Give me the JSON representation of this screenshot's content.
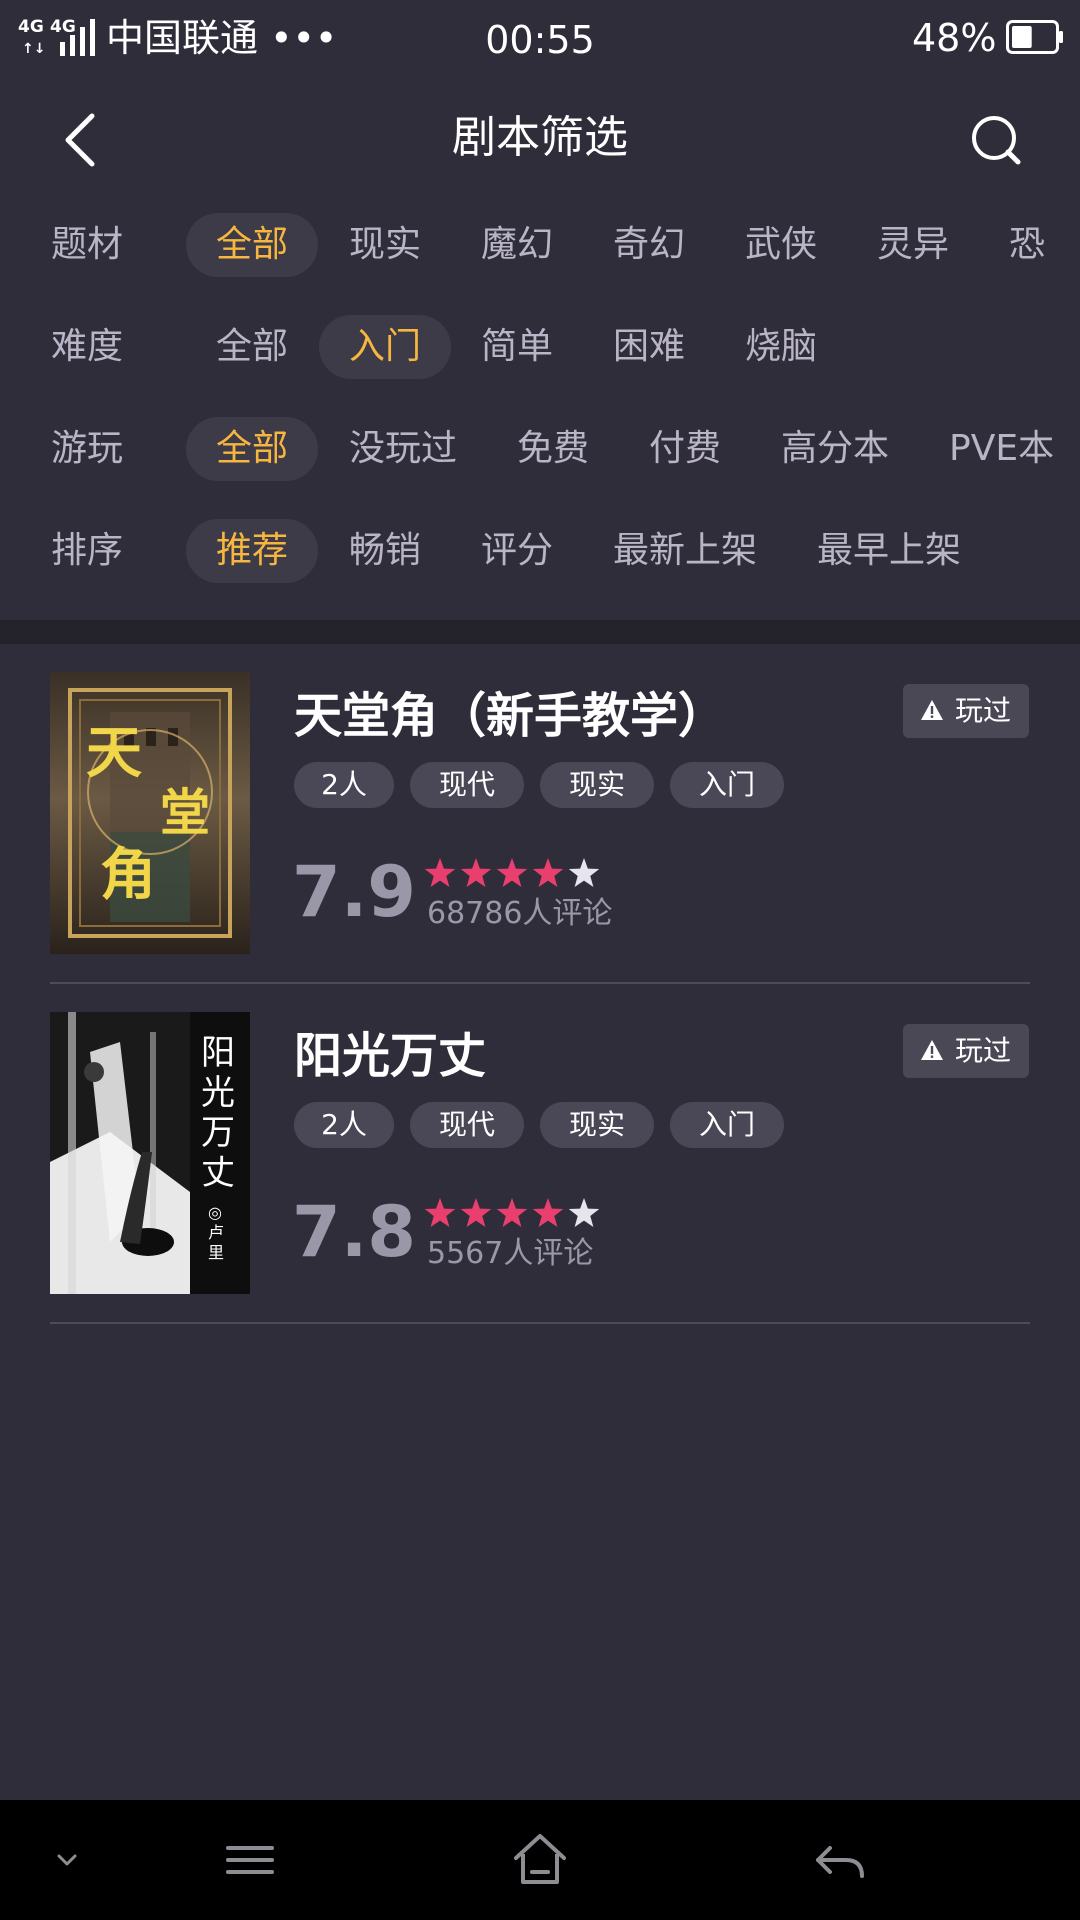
{
  "status_bar": {
    "network_1": "4G",
    "network_2": "4G",
    "carrier": "中国联通 •••",
    "time": "00:55",
    "battery": "48%",
    "battery_level": 0.48
  },
  "header": {
    "title": "剧本筛选",
    "back_icon": "chevron-left-icon",
    "search_icon": "search-icon"
  },
  "filters": [
    {
      "label": "题材",
      "options": [
        "全部",
        "现实",
        "魔幻",
        "奇幻",
        "武侠",
        "灵异",
        "恐"
      ],
      "selected": "全部"
    },
    {
      "label": "难度",
      "options": [
        "全部",
        "入门",
        "简单",
        "困难",
        "烧脑"
      ],
      "selected": "入门"
    },
    {
      "label": "游玩",
      "options": [
        "全部",
        "没玩过",
        "免费",
        "付费",
        "高分本",
        "PVE本"
      ],
      "selected": "全部"
    },
    {
      "label": "排序",
      "options": [
        "推荐",
        "畅销",
        "评分",
        "最新上架",
        "最早上架"
      ],
      "selected": "推荐"
    }
  ],
  "scripts": [
    {
      "title": "天堂角（新手教学）",
      "cover_text": "天堂角",
      "played_label": "玩过",
      "tags": [
        "2人",
        "现代",
        "现实",
        "入门"
      ],
      "score": "7.9",
      "stars": 4,
      "reviews": "68786人评论"
    },
    {
      "title": "阳光万丈",
      "cover_text": "阳光万丈",
      "cover_author": "◎卢里",
      "played_label": "玩过",
      "tags": [
        "2人",
        "现代",
        "现实",
        "入门"
      ],
      "score": "7.8",
      "stars": 4,
      "reviews": "5567人评论"
    }
  ],
  "nav_bar": {
    "icons": [
      "chevron-down-icon",
      "menu-icon",
      "home-icon",
      "back-arrow-icon"
    ]
  },
  "colors": {
    "background": "#302d3b",
    "accent": "#f6b63f",
    "star_filled": "#e83f6f",
    "star_empty": "#e6e5ee"
  }
}
